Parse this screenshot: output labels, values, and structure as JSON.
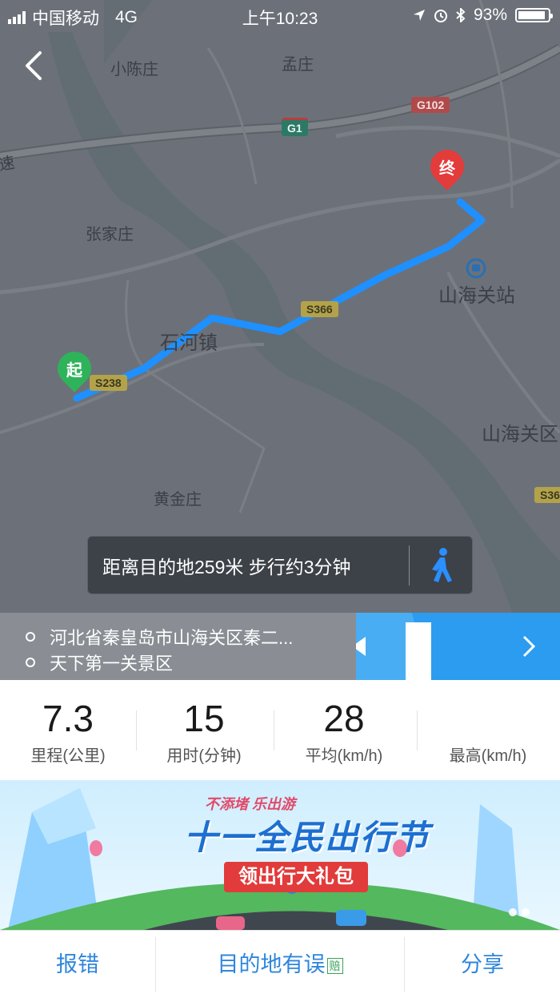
{
  "status_bar": {
    "carrier": "中国移动",
    "network": "4G",
    "time": "上午10:23",
    "battery": "93%",
    "battery_level": 0.93
  },
  "map": {
    "labels": [
      {
        "text": "小陈庄"
      },
      {
        "text": "孟庄"
      },
      {
        "text": "张家庄"
      },
      {
        "text": "石河镇"
      },
      {
        "text": "山海关站"
      },
      {
        "text": "山海关区"
      },
      {
        "text": "黄金庄"
      },
      {
        "text": "速"
      }
    ],
    "road_shields": [
      {
        "text": "G1"
      },
      {
        "text": "G102"
      },
      {
        "text": "S366"
      },
      {
        "text": "S238"
      },
      {
        "text": "S36"
      }
    ],
    "start_marker": "起",
    "end_marker": "终",
    "route_color": "#1e90ff"
  },
  "distance_info": "距离目的地259米 步行约3分钟",
  "address": {
    "start": "河北省秦皇岛市山海关区秦二...",
    "end": "天下第一关景区"
  },
  "stats": [
    {
      "value": "7.3",
      "label": "里程(公里)"
    },
    {
      "value": "15",
      "label": "用时(分钟)"
    },
    {
      "value": "28",
      "label": "平均(km/h)"
    },
    {
      "value": "",
      "label": "最高(km/h)"
    }
  ],
  "banner": {
    "tagline": "不添堵 乐出游",
    "title": "十一全民出行节",
    "ribbon": "领出行大礼包"
  },
  "bottom_bar": {
    "report_error": "报错",
    "destination_wrong": "目的地有误",
    "compensate_badge": "赔",
    "share": "分享"
  },
  "icons": [
    "back-arrow-icon",
    "signal-icon",
    "location-arrow-icon",
    "alarm-icon",
    "bluetooth-icon",
    "battery-icon",
    "walk-icon",
    "chevron-right-icon",
    "train-station-icon"
  ]
}
